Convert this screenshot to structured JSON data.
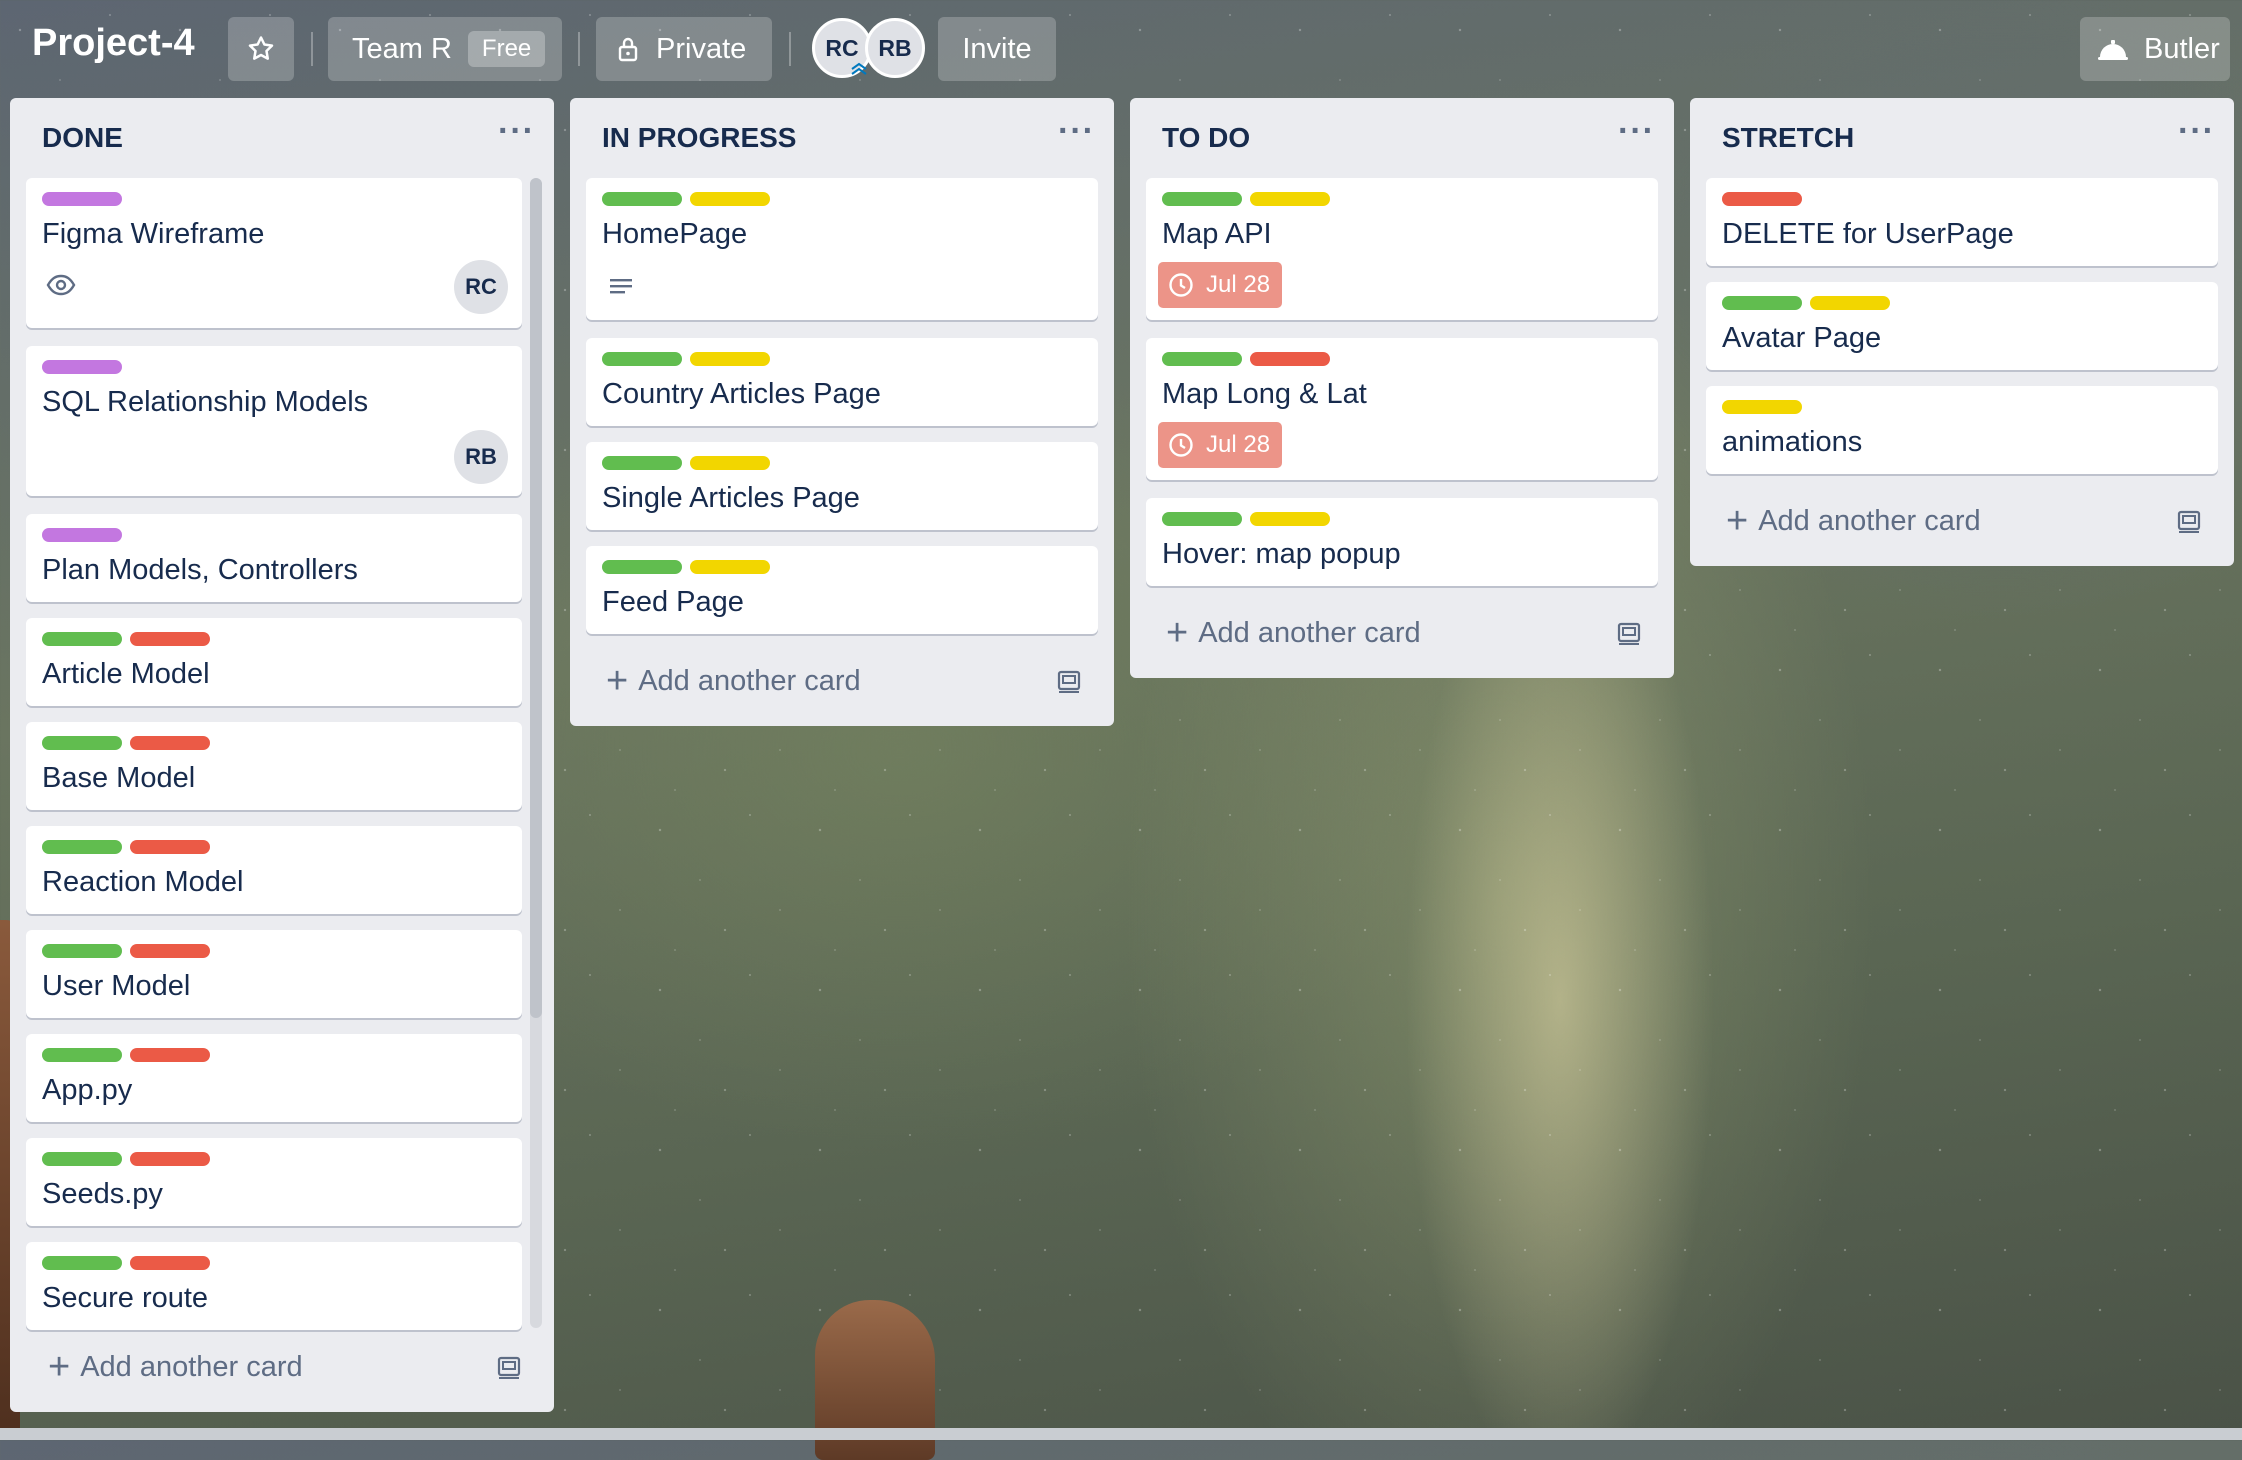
{
  "header": {
    "board_title": "Project-4",
    "team_label": "Team R",
    "team_badge": "Free",
    "visibility_label": "Private",
    "members": [
      "RC",
      "RB"
    ],
    "invite_label": "Invite",
    "butler_label": "Butler"
  },
  "label_colors": {
    "purple": "#c377e0",
    "green": "#61bd4f",
    "red": "#eb5a46",
    "yellow": "#f2d600"
  },
  "lists": [
    {
      "title": "DONE",
      "add_card": "Add another card",
      "cards": [
        {
          "title": "Figma Wireframe",
          "labels": [
            "purple"
          ],
          "badges": [
            "eye-icon"
          ],
          "member": "RC"
        },
        {
          "title": "SQL Relationship Models",
          "labels": [
            "purple"
          ],
          "member": "RB"
        },
        {
          "title": "Plan Models, Controllers",
          "labels": [
            "purple"
          ]
        },
        {
          "title": "Article Model",
          "labels": [
            "green",
            "red"
          ]
        },
        {
          "title": "Base Model",
          "labels": [
            "green",
            "red"
          ]
        },
        {
          "title": "Reaction Model",
          "labels": [
            "green",
            "red"
          ]
        },
        {
          "title": "User Model",
          "labels": [
            "green",
            "red"
          ]
        },
        {
          "title": "App.py",
          "labels": [
            "green",
            "red"
          ]
        },
        {
          "title": "Seeds.py",
          "labels": [
            "green",
            "red"
          ]
        },
        {
          "title": "Secure route",
          "labels": [
            "green",
            "red"
          ]
        }
      ]
    },
    {
      "title": "IN PROGRESS",
      "add_card": "Add another card",
      "cards": [
        {
          "title": "HomePage",
          "labels": [
            "green",
            "yellow"
          ],
          "badges": [
            "description-icon"
          ]
        },
        {
          "title": "Country Articles Page",
          "labels": [
            "green",
            "yellow"
          ]
        },
        {
          "title": "Single Articles Page",
          "labels": [
            "green",
            "yellow"
          ]
        },
        {
          "title": "Feed Page",
          "labels": [
            "green",
            "yellow"
          ]
        }
      ]
    },
    {
      "title": "TO DO",
      "add_card": "Add another card",
      "cards": [
        {
          "title": "Map API",
          "labels": [
            "green",
            "yellow"
          ],
          "due": "Jul 28"
        },
        {
          "title": "Map Long & Lat",
          "labels": [
            "green",
            "red"
          ],
          "due": "Jul 28"
        },
        {
          "title": "Hover: map popup",
          "labels": [
            "green",
            "yellow"
          ]
        }
      ]
    },
    {
      "title": "STRETCH",
      "add_card": "Add another card",
      "cards": [
        {
          "title": "DELETE for UserPage",
          "labels": [
            "red"
          ]
        },
        {
          "title": "Avatar Page",
          "labels": [
            "green",
            "yellow"
          ]
        },
        {
          "title": "animations",
          "labels": [
            "yellow"
          ]
        }
      ]
    }
  ]
}
